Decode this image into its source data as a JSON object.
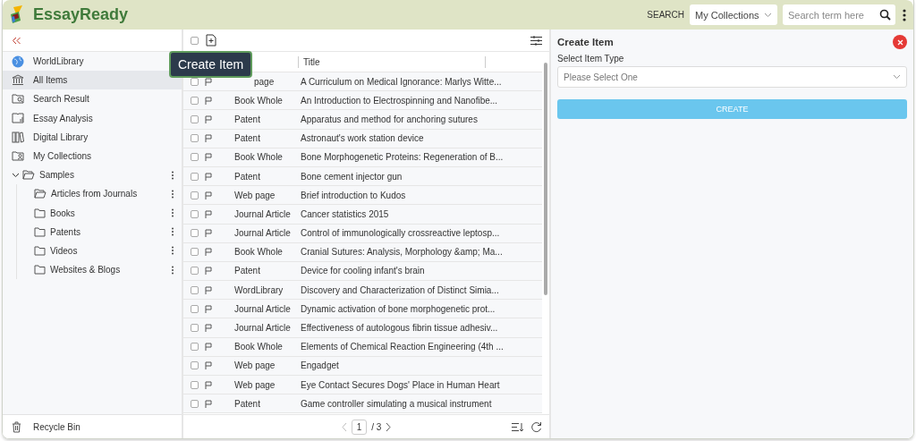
{
  "header": {
    "logo": "EssayReady",
    "search_label": "SEARCH",
    "scope": "My Collections",
    "search_placeholder": "Search term here"
  },
  "sidebar": {
    "items": [
      {
        "label": "WorldLibrary",
        "selected": false
      },
      {
        "label": "All Items",
        "selected": true
      },
      {
        "label": "Search Result",
        "selected": false
      },
      {
        "label": "Essay Analysis",
        "selected": false
      },
      {
        "label": "Digital Library",
        "selected": false
      },
      {
        "label": "My Collections",
        "selected": false
      }
    ],
    "tree": [
      {
        "label": "Samples",
        "expanded": true,
        "children": [
          {
            "label": "Articles from Journals",
            "expanded": true
          },
          {
            "label": "Books",
            "expanded": false
          },
          {
            "label": "Patents",
            "expanded": false
          },
          {
            "label": "Videos",
            "expanded": false
          },
          {
            "label": "Websites & Blogs",
            "expanded": false
          }
        ]
      }
    ],
    "footer": "Recycle Bin"
  },
  "list": {
    "select_all_checked": false,
    "tooltip": "Create Item",
    "columns": [
      "Title"
    ],
    "rows": [
      {
        "checked": false,
        "type": "page",
        "title": "A Curriculum on Medical Ignorance: Marlys Witte..."
      },
      {
        "checked": false,
        "type": "Book Whole",
        "title": "An Introduction to Electrospinning and Nanofibe..."
      },
      {
        "checked": false,
        "type": "Patent",
        "title": "Apparatus and method for anchoring sutures"
      },
      {
        "checked": false,
        "type": "Patent",
        "title": "Astronaut's work station device"
      },
      {
        "checked": false,
        "type": "Book Whole",
        "title": "Bone Morphogenetic Proteins: Regeneration of B..."
      },
      {
        "checked": false,
        "type": "Patent",
        "title": "Bone cement injector gun"
      },
      {
        "checked": false,
        "type": "Web page",
        "title": "Brief introduction to Kudos"
      },
      {
        "checked": false,
        "type": "Journal Article",
        "title": "Cancer statistics 2015"
      },
      {
        "checked": false,
        "type": "Journal Article",
        "title": "Control of immunologically crossreactive leptosp..."
      },
      {
        "checked": false,
        "type": "Book Whole",
        "title": "Cranial Sutures: Analysis, Morphology &amp; Ma..."
      },
      {
        "checked": false,
        "type": "Patent",
        "title": "Device for cooling infant's brain"
      },
      {
        "checked": false,
        "type": "WordLibrary",
        "title": "Discovery and Characterization of Distinct Simia..."
      },
      {
        "checked": false,
        "type": "Journal Article",
        "title": "Dynamic activation of bone morphogenetic prot..."
      },
      {
        "checked": false,
        "type": "Journal Article",
        "title": "Effectiveness of autologous fibrin tissue adhesiv..."
      },
      {
        "checked": false,
        "type": "Book Whole",
        "title": "Elements of Chemical Reaction Engineering (4th ..."
      },
      {
        "checked": false,
        "type": "Web page",
        "title": "Engadget"
      },
      {
        "checked": false,
        "type": "Web page",
        "title": "Eye Contact Secures Dogs' Place in Human Heart"
      },
      {
        "checked": false,
        "type": "Patent",
        "title": "Game controller simulating a musical instrument"
      }
    ],
    "page": "1",
    "page_total": "/ 3"
  },
  "panel": {
    "title": "Create Item",
    "field_label": "Select Item Type",
    "placeholder": "Please Select One",
    "button": "CREATE"
  }
}
